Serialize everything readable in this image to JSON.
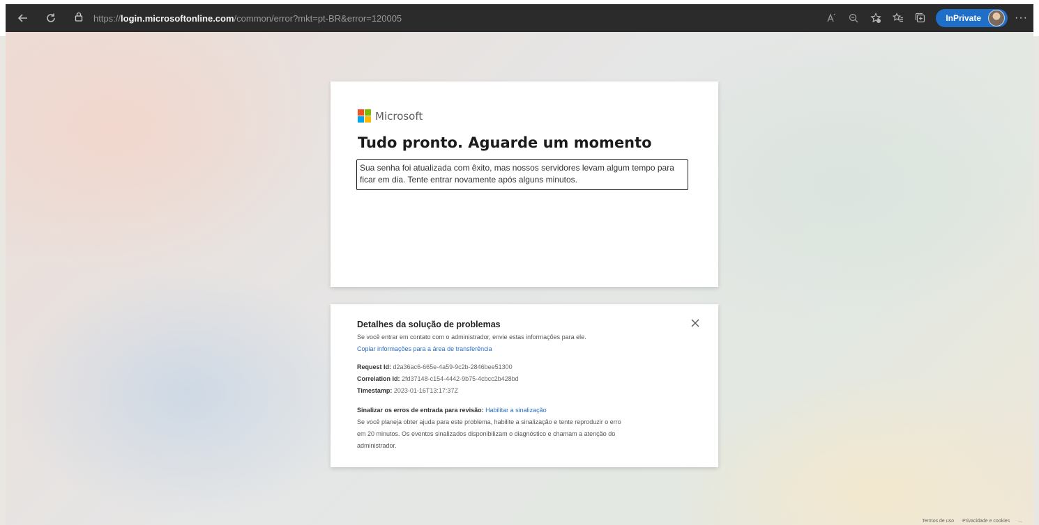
{
  "browser": {
    "url_protocol": "https://",
    "url_host": "login.microsoftonline.com",
    "url_path": "/common/error?mkt=pt-BR&error=120005",
    "inprivate_label": "InPrivate",
    "more_label": "···"
  },
  "main_card": {
    "brand": "Microsoft",
    "title": "Tudo pronto. Aguarde um momento",
    "message": "Sua senha foi atualizada com êxito, mas nossos servidores levam algum tempo para ficar em dia. Tente entrar novamente após alguns minutos."
  },
  "details_card": {
    "title": "Detalhes da solução de problemas",
    "intro": "Se você entrar em contato com o administrador, envie estas informações para ele.",
    "copy_link": "Copiar informações para a área de transferência",
    "request_id_label": "Request Id:",
    "request_id": "d2a36ac6-665e-4a59-9c2b-2846bee51300",
    "correlation_id_label": "Correlation Id:",
    "correlation_id": "2fd37148-c154-4442-9b75-4cbcc2b428bd",
    "timestamp_label": "Timestamp:",
    "timestamp": "2023-01-16T13:17:37Z",
    "flag_label": "Sinalizar os erros de entrada para revisão:",
    "flag_link": "Habilitar a sinalização",
    "flag_text_1": "Se você planeja obter ajuda para este problema, habilite a sinalização e tente reproduzir o erro",
    "flag_text_2": "em 20 minutos. Os eventos sinalizados disponibilizam o diagnóstico e chamam a atenção do",
    "flag_text_3": "administrador."
  },
  "footer": {
    "terms": "Termos de uso",
    "privacy": "Privacidade e cookies",
    "more": "..."
  },
  "colors": {
    "ms_red": "#f25022",
    "ms_green": "#7fba00",
    "ms_blue": "#00a4ef",
    "ms_yellow": "#ffb900",
    "accent_link": "#2a6fc9",
    "inprivate_bg": "#1f6ec7"
  }
}
